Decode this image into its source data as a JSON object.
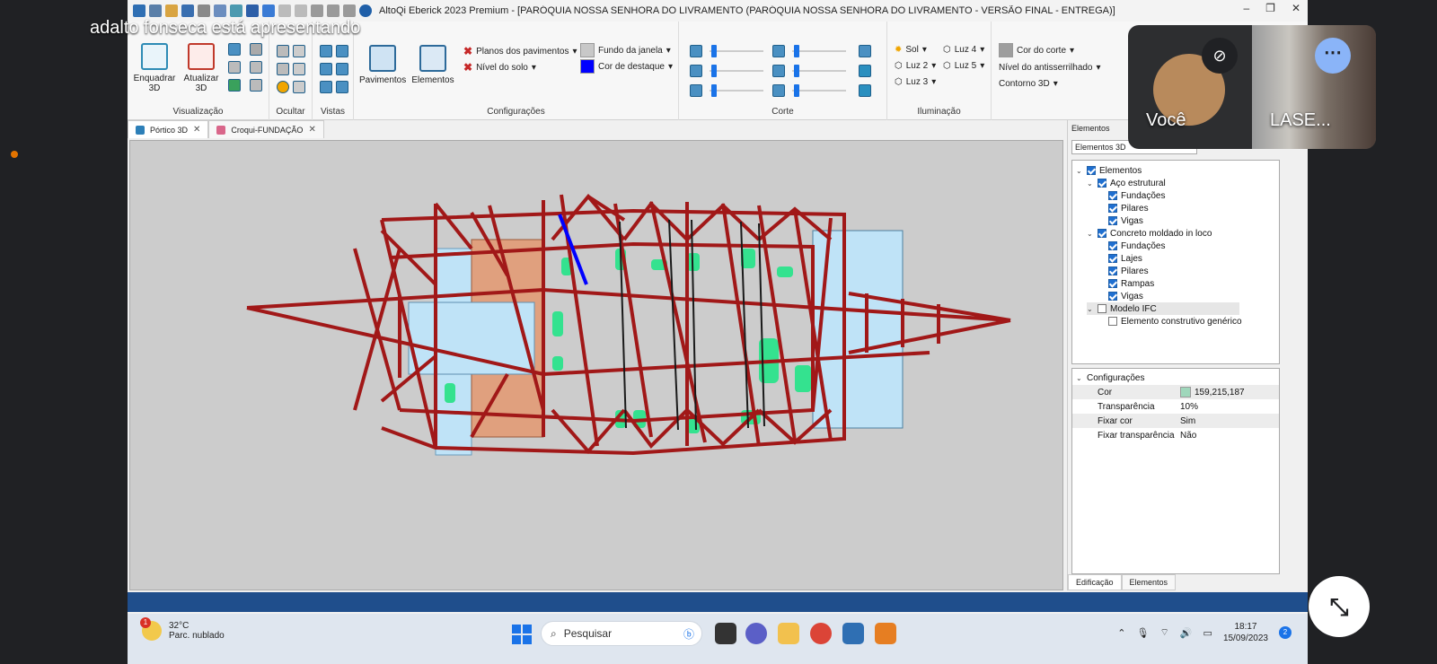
{
  "meet": {
    "presenter_text": "adalto fonseca está apresentando",
    "you_name": "Você",
    "other_name": "LASE...",
    "mic_off_icon": "mic-off-icon",
    "more_icon": "more-options-icon",
    "exit_icon": "exit-fullscreen-icon"
  },
  "app": {
    "title": "AltoQi Eberick 2023 Premium - [PARÓQUIA NOSSA SENHORA DO LIVRAMENTO (PARÓQUIA NOSSA SENHORA DO LIVRAMENTO - VERSÃO FINAL - ENTREGA)]"
  },
  "ribbon": {
    "visualizacao": {
      "label": "Visualização",
      "enquadrar": "Enquadrar 3D",
      "atualizar": "Atualizar 3D"
    },
    "ocultar": {
      "label": "Ocultar"
    },
    "vistas": {
      "label": "Vistas"
    },
    "configuracoes": {
      "label": "Configurações",
      "pavimentos": "Pavimentos",
      "elementos": "Elementos",
      "planos": "Planos dos pavimentos",
      "nivel_solo": "Nível do solo",
      "fundo_janela": "Fundo da janela",
      "cor_destaque": "Cor de destaque"
    },
    "corte": {
      "label": "Corte"
    },
    "iluminacao": {
      "label": "Iluminação",
      "sol": "Sol",
      "luz2": "Luz 2",
      "luz3": "Luz 3",
      "luz4": "Luz 4",
      "luz5": "Luz 5"
    },
    "extras": {
      "cor_corte": "Cor do corte",
      "nivel_antisserrilhado": "Nível do antisserrilhado",
      "contorno_3d": "Contorno 3D"
    }
  },
  "tabs": [
    {
      "label": "Pórtico 3D"
    },
    {
      "label": "Croqui-FUNDAÇÃO"
    }
  ],
  "panel": {
    "title": "Elementos",
    "select": "Elementos 3D",
    "tree": [
      {
        "label": "Elementos"
      },
      {
        "label": "Aço estrutural"
      },
      {
        "label": "Fundações"
      },
      {
        "label": "Pilares"
      },
      {
        "label": "Vigas"
      },
      {
        "label": "Concreto moldado in loco"
      },
      {
        "label": "Fundações"
      },
      {
        "label": "Lajes"
      },
      {
        "label": "Pilares"
      },
      {
        "label": "Rampas"
      },
      {
        "label": "Vigas"
      },
      {
        "label": "Modelo IFC"
      },
      {
        "label": "Elemento construtivo genérico"
      }
    ],
    "props_header": "Configurações",
    "props": [
      {
        "key": "Cor",
        "value": "159,215,187"
      },
      {
        "key": "Transparência",
        "value": "10%"
      },
      {
        "key": "Fixar cor",
        "value": "Sim"
      },
      {
        "key": "Fixar transparência",
        "value": "Não"
      }
    ],
    "bottom_tabs": [
      "Edificação",
      "Elementos"
    ]
  },
  "taskbar": {
    "temp": "32°C",
    "weather_desc": "Parc. nublado",
    "weather_badge": "1",
    "search_placeholder": "Pesquisar",
    "time": "18:17",
    "date": "15/09/2023",
    "notif_count": "2"
  },
  "colors": {
    "accent": "#1a73e8",
    "frame_red": "#a11818",
    "slab_blue": "#bfe3f7",
    "slab_orange": "#e0a07e",
    "green": "#34e28f",
    "highlight_blue": "#0000ff",
    "prop_color": "#9fd7bb"
  }
}
